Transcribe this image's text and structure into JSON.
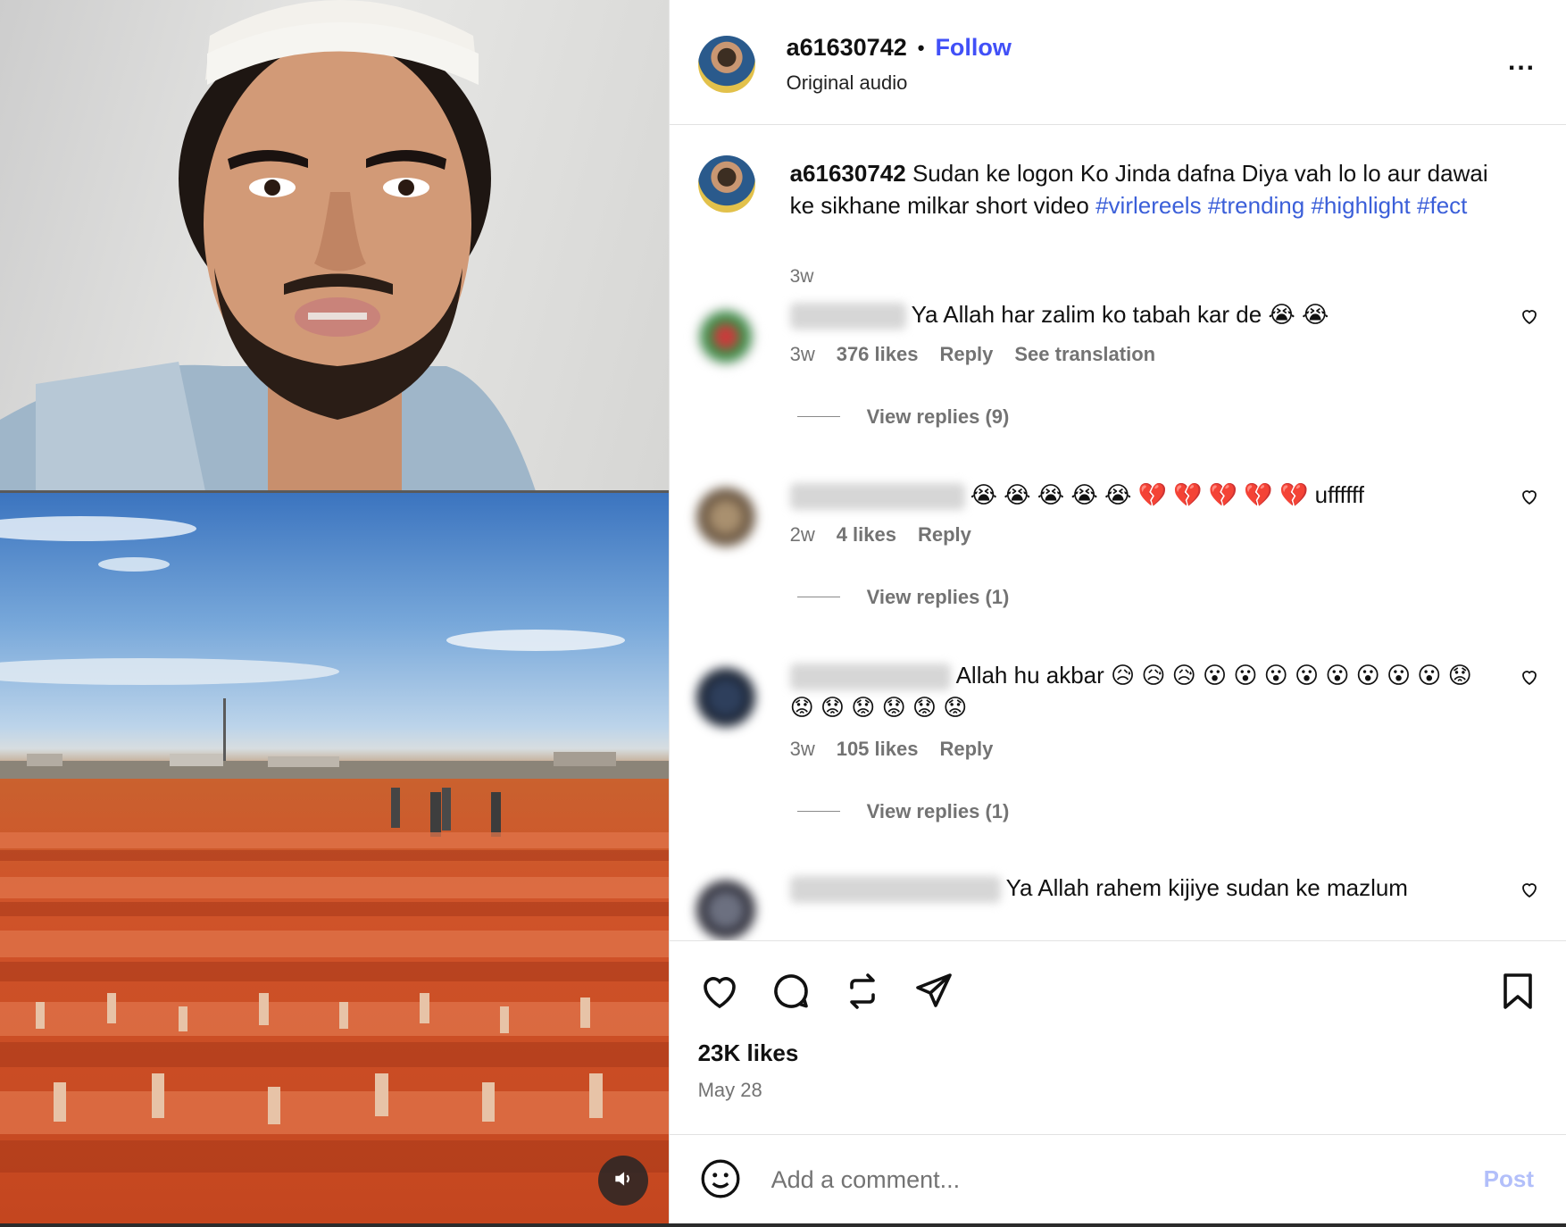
{
  "post": {
    "username": "a61630742",
    "separator": "•",
    "follow_label": "Follow",
    "audio": "Original audio",
    "more_label": "...",
    "sound_icon": "speaker-icon"
  },
  "caption": {
    "username": "a61630742",
    "text": "Sudan ke logon Ko Jinda dafna Diya vah lo lo aur dawai ke sikhane milkar short video",
    "tags": [
      "#virlereels",
      "#trending",
      "#highlight",
      "#fect"
    ],
    "time": "3w"
  },
  "comments": [
    {
      "text": "Ya Allah har zalim ko tabah kar de 😭 😭",
      "time": "3w",
      "likes": "376 likes",
      "reply": "Reply",
      "translation": "See translation",
      "replies": "View replies (9)"
    },
    {
      "text": "😭 😭 😭 😭 😭 💔 💔 💔 💔 💔 uffffff",
      "time": "2w",
      "likes": "4 likes",
      "reply": "Reply",
      "replies": "View replies (1)"
    },
    {
      "text": "Allah hu akbar 😥 😥 😥 😮 😮 😮 😮 😮 😮 😮 😮 😟 😟 😟 😟 😟 😟 😟",
      "time": "3w",
      "likes": "105 likes",
      "reply": "Reply",
      "replies": "View replies (1)"
    },
    {
      "text": "Ya Allah rahem kijiye sudan ke mazlum"
    }
  ],
  "actions": {
    "likes": "23K likes",
    "date": "May 28",
    "icons": [
      "heart-icon",
      "comment-icon",
      "repost-icon",
      "share-icon",
      "bookmark-icon"
    ]
  },
  "add_comment": {
    "placeholder": "Add a comment...",
    "post_label": "Post"
  },
  "colors": {
    "follow": "#4150f7",
    "hashtag": "#3b5fd9",
    "muted": "#737373",
    "post_disabled": "#b2bffa"
  }
}
